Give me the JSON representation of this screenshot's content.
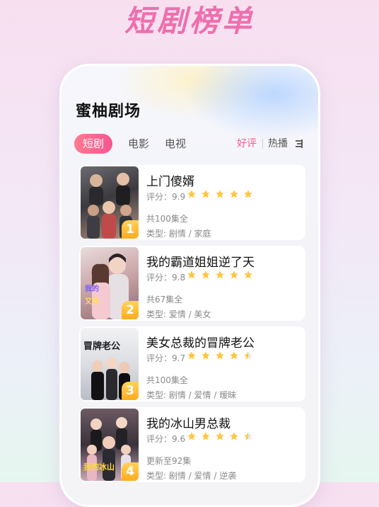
{
  "banner_title": "短剧榜单",
  "app": {
    "title": "蜜柚剧场",
    "category_tabs": [
      {
        "label": "短剧",
        "active": true
      },
      {
        "label": "电影",
        "active": false
      },
      {
        "label": "电视",
        "active": false
      }
    ],
    "sort_options": [
      {
        "label": "好评",
        "active": true
      },
      {
        "label": "热播",
        "active": false
      }
    ],
    "filter_icon": "filter-icon"
  },
  "list": [
    {
      "rank": "1",
      "title": "上门傻婿",
      "score": "评分：9.9",
      "stars": 5,
      "episodes": "共100集全",
      "genre": "类型: 剧情 / 家庭",
      "poster_colors": [
        "#4a4a52",
        "#c9a98e"
      ]
    },
    {
      "rank": "2",
      "title": "我的霸道姐姐逆了天",
      "score": "评分：9.8",
      "stars": 5,
      "episodes": "共67集全",
      "genre": "类型: 爱情 / 美女",
      "poster_colors": [
        "#c7a6a9",
        "#e8d7d6"
      ]
    },
    {
      "rank": "3",
      "title": "美女总裁的冒牌老公",
      "score": "评分：9.7",
      "stars": 4.5,
      "episodes": "共100集全",
      "genre": "类型: 剧情 / 爱情 / 暧昧",
      "poster_colors": [
        "#d9dde2",
        "#2d2d33"
      ]
    },
    {
      "rank": "4",
      "title": "我的冰山男总裁",
      "score": "评分：9.6",
      "stars": 4.5,
      "episodes": "更新至92集",
      "genre": "类型: 剧情 / 爱情 / 逆袭",
      "poster_colors": [
        "#3b3340",
        "#caa9b6"
      ]
    }
  ],
  "colors": {
    "accent": "#f25b8f",
    "star": "#ffc53d",
    "rank_badge": "#ffab1c",
    "banner": "#ee6fae"
  }
}
